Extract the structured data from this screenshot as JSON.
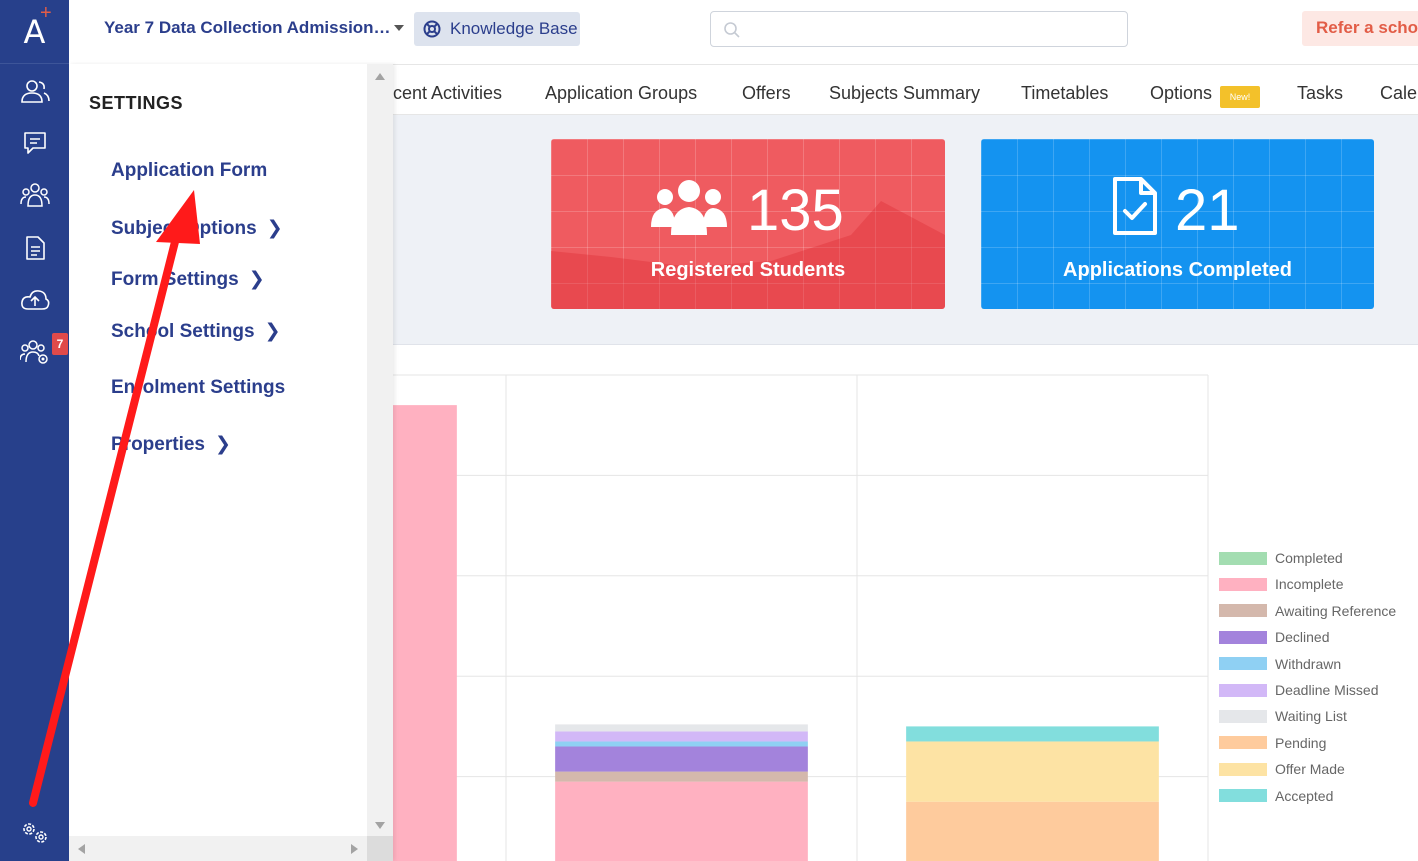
{
  "header": {
    "app_title": "Year 7 Data Collection Admission…",
    "knowledge_base_label": "Knowledge Base",
    "search_placeholder": "",
    "refer_label": "Refer a scho"
  },
  "rail": {
    "logo_text": "A",
    "items": [
      {
        "icon": "users-icon"
      },
      {
        "icon": "message-icon"
      },
      {
        "icon": "group-icon"
      },
      {
        "icon": "document-icon"
      },
      {
        "icon": "cloud-upload-icon"
      },
      {
        "icon": "group-settings-icon",
        "badge": "7"
      },
      {
        "icon": "settings-icon"
      }
    ]
  },
  "tabs": [
    {
      "label": "cent Activities"
    },
    {
      "label": "Application Groups"
    },
    {
      "label": "Offers"
    },
    {
      "label": "Subjects Summary"
    },
    {
      "label": "Timetables"
    },
    {
      "label": "Options"
    },
    {
      "label": "Tasks"
    },
    {
      "label": "Cale"
    }
  ],
  "new_badge": "New!",
  "stats": {
    "registered": {
      "value": "135",
      "label": "Registered Students"
    },
    "completed": {
      "value": "21",
      "label": "Applications Completed"
    }
  },
  "settings_menu": {
    "title": "SETTINGS",
    "items": [
      {
        "label": "Application Form",
        "has_submenu": false
      },
      {
        "label": "Subject Options",
        "has_submenu": true
      },
      {
        "label": "Form Settings",
        "has_submenu": true
      },
      {
        "label": "School Settings",
        "has_submenu": true
      },
      {
        "label": "Enrolment Settings",
        "has_submenu": false
      },
      {
        "label": "Properties",
        "has_submenu": true
      }
    ]
  },
  "colors": {
    "rail": "#27408b",
    "link": "#2b3e8c",
    "card_red": "#ef5b60",
    "card_blue": "#1493f0",
    "annotation_arrow": "#ff1a1a"
  },
  "chart_data": {
    "type": "bar",
    "stacked": true,
    "grid": true,
    "legend_position": "right",
    "categories": [
      "",
      "",
      ""
    ],
    "series": [
      {
        "name": "Completed",
        "color": "#a3ddb1",
        "values": [
          0,
          0,
          0
        ]
      },
      {
        "name": "Incomplete",
        "color": "#ffb1c1",
        "values": [
          47,
          9.5,
          0
        ]
      },
      {
        "name": "Awaiting Reference",
        "color": "#d4b8ac",
        "values": [
          0,
          1,
          0
        ]
      },
      {
        "name": "Declined",
        "color": "#a383dc",
        "values": [
          0,
          2.5,
          0
        ]
      },
      {
        "name": "Withdrawn",
        "color": "#8fd0f3",
        "values": [
          0,
          0.5,
          0
        ]
      },
      {
        "name": "Deadline Missed",
        "color": "#d2b8f7",
        "values": [
          0,
          1,
          0
        ]
      },
      {
        "name": "Waiting List",
        "color": "#e5e7ea",
        "values": [
          0,
          0.7,
          0
        ]
      },
      {
        "name": "Pending",
        "color": "#fecb9d",
        "values": [
          0,
          0,
          7.5
        ]
      },
      {
        "name": "Offer Made",
        "color": "#fde3a4",
        "values": [
          0,
          0,
          6
        ]
      },
      {
        "name": "Accepted",
        "color": "#82dedd",
        "values": [
          0,
          0,
          1.5
        ]
      }
    ]
  }
}
